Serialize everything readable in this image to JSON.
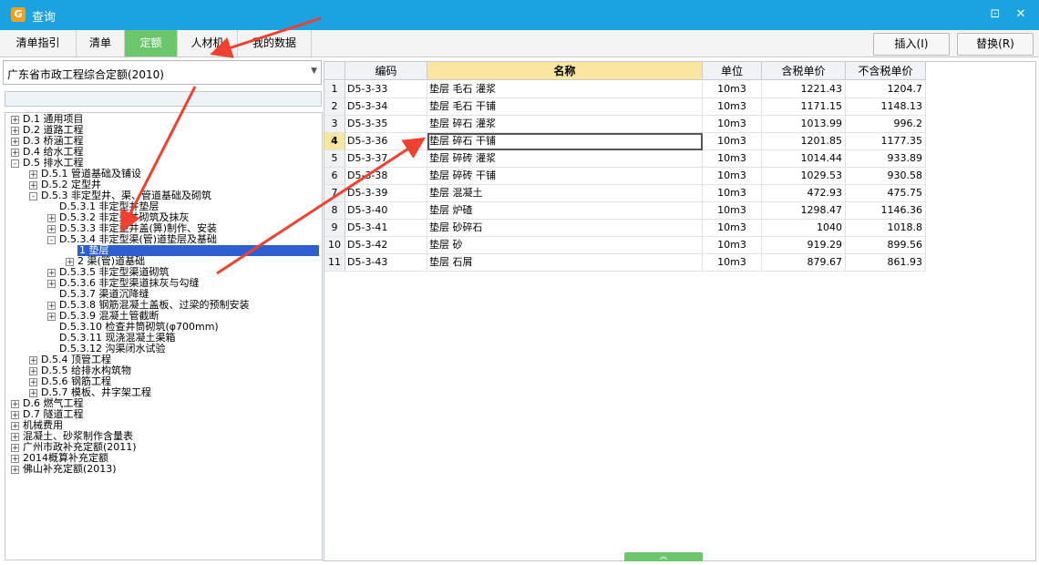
{
  "window": {
    "title": "查询",
    "app_icon": "app-logo-icon",
    "restore": "⊡",
    "close": "✕"
  },
  "tabs": [
    {
      "label": "清单指引",
      "active": false
    },
    {
      "label": "清单",
      "active": false
    },
    {
      "label": "定额",
      "active": true
    },
    {
      "label": "人材机",
      "active": false
    },
    {
      "label": "我的数据",
      "active": false
    }
  ],
  "actions": {
    "insert": "插入(I)",
    "replace": "替换(R)"
  },
  "library": {
    "selected": "广东省市政工程综合定额(2010)",
    "filter_value": ""
  },
  "tree": [
    {
      "label": "D.1 通用项目",
      "level": 0,
      "toggle": "+",
      "selected": false
    },
    {
      "label": "D.2 道路工程",
      "level": 0,
      "toggle": "+",
      "selected": false
    },
    {
      "label": "D.3 桥涵工程",
      "level": 0,
      "toggle": "+",
      "selected": false
    },
    {
      "label": "D.4 给水工程",
      "level": 0,
      "toggle": "+",
      "selected": false
    },
    {
      "label": "D.5 排水工程",
      "level": 0,
      "toggle": "-",
      "selected": false
    },
    {
      "label": "D.5.1 管道基础及铺设",
      "level": 1,
      "toggle": "+",
      "selected": false
    },
    {
      "label": "D.5.2 定型井",
      "level": 1,
      "toggle": "+",
      "selected": false
    },
    {
      "label": "D.5.3 非定型井、渠、管道基础及砌筑",
      "level": 1,
      "toggle": "-",
      "selected": false
    },
    {
      "label": "D.5.3.1 非定型井垫层",
      "level": 2,
      "toggle": "",
      "selected": false
    },
    {
      "label": "D.5.3.2 非定型井砌筑及抹灰",
      "level": 2,
      "toggle": "+",
      "selected": false
    },
    {
      "label": "D.5.3.3 非定型井盖(箅)制作、安装",
      "level": 2,
      "toggle": "+",
      "selected": false
    },
    {
      "label": "D.5.3.4 非定型渠(管)道垫层及基础",
      "level": 2,
      "toggle": "-",
      "selected": false
    },
    {
      "label": "1 垫层",
      "level": 3,
      "toggle": "",
      "selected": true
    },
    {
      "label": "2 渠(管)道基础",
      "level": 3,
      "toggle": "+",
      "selected": false
    },
    {
      "label": "D.5.3.5 非定型渠道砌筑",
      "level": 2,
      "toggle": "+",
      "selected": false
    },
    {
      "label": "D.5.3.6 非定型渠道抹灰与勾缝",
      "level": 2,
      "toggle": "+",
      "selected": false
    },
    {
      "label": "D.5.3.7 渠道沉降缝",
      "level": 2,
      "toggle": "",
      "selected": false
    },
    {
      "label": "D.5.3.8 钢筋混凝土盖板、过梁的预制安装",
      "level": 2,
      "toggle": "+",
      "selected": false
    },
    {
      "label": "D.5.3.9 混凝土管截断",
      "level": 2,
      "toggle": "+",
      "selected": false
    },
    {
      "label": "D.5.3.10 检查井筒砌筑(φ700mm)",
      "level": 2,
      "toggle": "",
      "selected": false
    },
    {
      "label": "D.5.3.11 现浇混凝土渠箱",
      "level": 2,
      "toggle": "",
      "selected": false
    },
    {
      "label": "D.5.3.12 沟渠闭水试验",
      "level": 2,
      "toggle": "",
      "selected": false
    },
    {
      "label": "D.5.4 顶管工程",
      "level": 1,
      "toggle": "+",
      "selected": false
    },
    {
      "label": "D.5.5 给排水构筑物",
      "level": 1,
      "toggle": "+",
      "selected": false
    },
    {
      "label": "D.5.6 钢筋工程",
      "level": 1,
      "toggle": "+",
      "selected": false
    },
    {
      "label": "D.5.7 模板、井字架工程",
      "level": 1,
      "toggle": "+",
      "selected": false
    },
    {
      "label": "D.6 燃气工程",
      "level": 0,
      "toggle": "+",
      "selected": false
    },
    {
      "label": "D.7 隧道工程",
      "level": 0,
      "toggle": "+",
      "selected": false
    },
    {
      "label": "机械费用",
      "level": 0,
      "toggle": "+",
      "selected": false
    },
    {
      "label": "混凝土、砂浆制作含量表",
      "level": 0,
      "toggle": "+",
      "selected": false
    },
    {
      "label": "广州市政补充定额(2011)",
      "level": 0,
      "toggle": "+",
      "selected": false
    },
    {
      "label": "2014概算补充定额",
      "level": 0,
      "toggle": "+",
      "selected": false
    },
    {
      "label": "佛山补充定额(2013)",
      "level": 0,
      "toggle": "+",
      "selected": false
    }
  ],
  "grid": {
    "columns": {
      "code": "编码",
      "name": "名称",
      "unit": "单位",
      "price_tax": "含税单价",
      "price_notax": "不含税单价"
    },
    "current_row": 4,
    "rows": [
      {
        "num": "1",
        "code": "D5-3-33",
        "name": "垫层 毛石 灌浆",
        "unit": "10m3",
        "price_tax": "1221.43",
        "price_notax": "1204.7"
      },
      {
        "num": "2",
        "code": "D5-3-34",
        "name": "垫层 毛石 干铺",
        "unit": "10m3",
        "price_tax": "1171.15",
        "price_notax": "1148.13"
      },
      {
        "num": "3",
        "code": "D5-3-35",
        "name": "垫层 碎石 灌浆",
        "unit": "10m3",
        "price_tax": "1013.99",
        "price_notax": "996.2"
      },
      {
        "num": "4",
        "code": "D5-3-36",
        "name": "垫层 碎石 干铺",
        "unit": "10m3",
        "price_tax": "1201.85",
        "price_notax": "1177.35"
      },
      {
        "num": "5",
        "code": "D5-3-37",
        "name": "垫层 碎砖 灌浆",
        "unit": "10m3",
        "price_tax": "1014.44",
        "price_notax": "933.89"
      },
      {
        "num": "6",
        "code": "D5-3-38",
        "name": "垫层 碎砖 干铺",
        "unit": "10m3",
        "price_tax": "1029.53",
        "price_notax": "930.58"
      },
      {
        "num": "7",
        "code": "D5-3-39",
        "name": "垫层 混凝土",
        "unit": "10m3",
        "price_tax": "472.93",
        "price_notax": "475.75"
      },
      {
        "num": "8",
        "code": "D5-3-40",
        "name": "垫层 炉碴",
        "unit": "10m3",
        "price_tax": "1298.47",
        "price_notax": "1146.36"
      },
      {
        "num": "9",
        "code": "D5-3-41",
        "name": "垫层 砂碎石",
        "unit": "10m3",
        "price_tax": "1040",
        "price_notax": "1018.8"
      },
      {
        "num": "10",
        "code": "D5-3-42",
        "name": "垫层 砂",
        "unit": "10m3",
        "price_tax": "919.29",
        "price_notax": "899.56"
      },
      {
        "num": "11",
        "code": "D5-3-43",
        "name": "垫层 石屑",
        "unit": "10m3",
        "price_tax": "879.67",
        "price_notax": "861.93"
      }
    ]
  },
  "colors": {
    "titlebar": "#1aa3e0",
    "active_tab": "#6cc76c",
    "highlight": "#fbe6a0",
    "selection": "#2d5fd0",
    "annotation_arrow": "#f04030"
  }
}
